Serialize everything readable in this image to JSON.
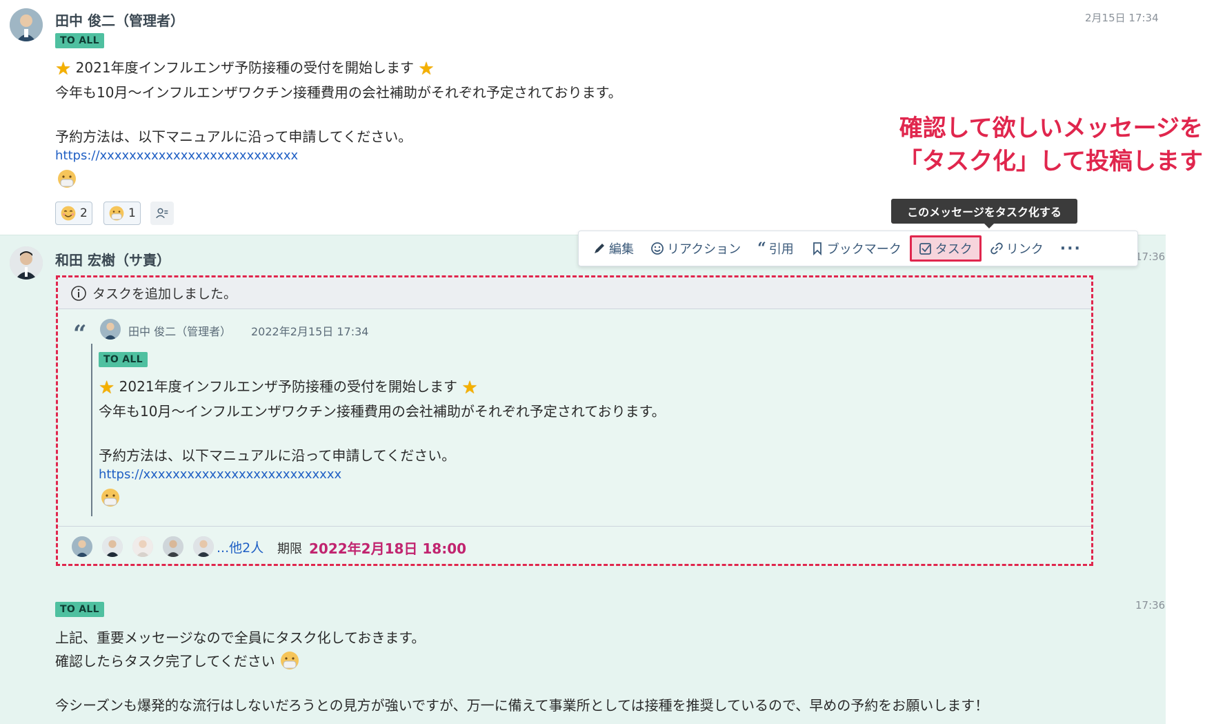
{
  "message1": {
    "author": "田中 俊二（管理者）",
    "time": "2月15日 17:34",
    "badge": "TO ALL",
    "title": "2021年度インフルエンザ予防接種の受付を開始します",
    "line2": "今年も10月〜インフルエンザワクチン接種費用の会社補助がそれぞれ予定されております。",
    "line3": "予約方法は、以下マニュアルに沿って申請してください。",
    "link": "https://xxxxxxxxxxxxxxxxxxxxxxxxxxx",
    "reactions": [
      {
        "icon": "smile-face-icon",
        "count": "2"
      },
      {
        "icon": "mask-face-icon",
        "count": "1"
      }
    ]
  },
  "annotation": {
    "line1": "確認して欲しいメッセージを",
    "line2": "「タスク化」して投稿します"
  },
  "tooltip": "このメッセージをタスク化する",
  "actions": {
    "edit": "編集",
    "reaction": "リアクション",
    "quote": "引用",
    "bookmark": "ブックマーク",
    "task": "タスク",
    "link": "リンク",
    "more": "···"
  },
  "message2": {
    "author": "和田 宏樹（サ責）",
    "time": "17:36",
    "task": {
      "header": "タスクを追加しました。",
      "quote_author": "田中 俊二（管理者）",
      "quote_time": "2022年2月15日 17:34",
      "badge": "TO ALL",
      "title": "2021年度インフルエンザ予防接種の受付を開始します",
      "line2": "今年も10月〜インフルエンザワクチン接種費用の会社補助がそれぞれ予定されております。",
      "line3": "予約方法は、以下マニュアルに沿って申請してください。",
      "link": "https://xxxxxxxxxxxxxxxxxxxxxxxxxxx",
      "others": "...他2人",
      "due_label": "期限",
      "due_value": "2022年2月18日 18:00"
    }
  },
  "message3": {
    "time": "17:36",
    "badge": "TO ALL",
    "line1": "上記、重要メッセージなので全員にタスク化しておきます。",
    "line2": "確認したらタスク完了してください",
    "line3": "今シーズンも爆発的な流行はしないだろうとの見方が強いですが、万一に備えて事業所としては接種を推奨しているので、早めの予約をお願いします！"
  },
  "colors": {
    "accent_red": "#e0264d",
    "badge_green": "#4fc0a0",
    "link_blue": "#1f5fc4",
    "due_magenta": "#c1246f",
    "thread_bg": "#e6f4f0"
  }
}
